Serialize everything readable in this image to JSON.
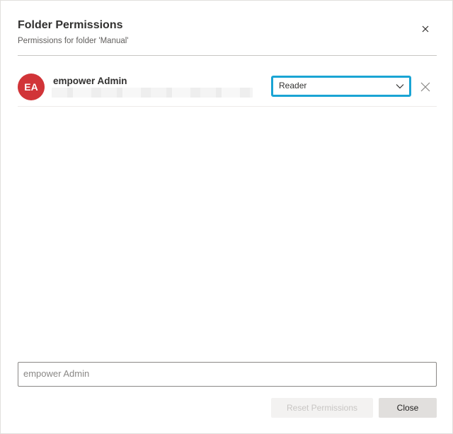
{
  "dialog": {
    "title": "Folder Permissions",
    "subtitle": "Permissions for folder 'Manual'"
  },
  "permissions": [
    {
      "initials": "EA",
      "name": "empower Admin",
      "role": "Reader",
      "avatar_color": "#d13438"
    }
  ],
  "people_picker": {
    "placeholder": "empower Admin"
  },
  "footer": {
    "reset_label": "Reset Permissions",
    "close_label": "Close"
  },
  "colors": {
    "focus_border": "#1aa4d4",
    "avatar": "#d13438"
  },
  "icons": {
    "dialog_close": "close-icon",
    "dropdown": "chevron-down-icon",
    "remove": "close-icon"
  }
}
